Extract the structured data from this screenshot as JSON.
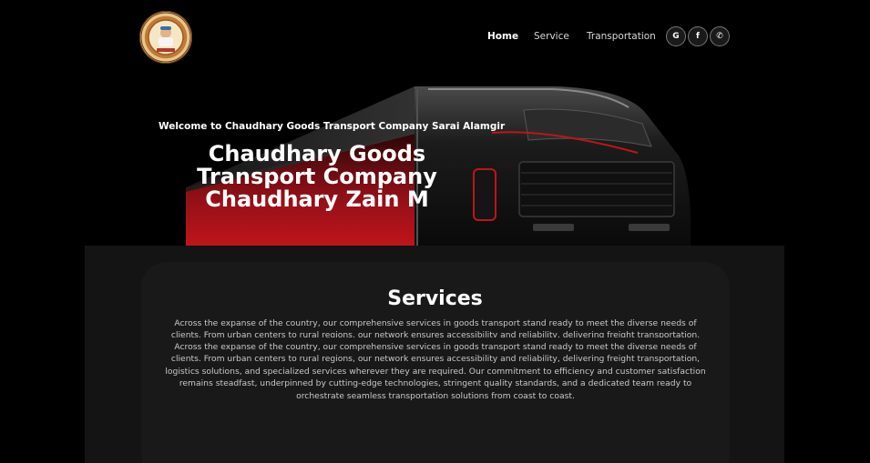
{
  "header": {
    "logo_icon": "company-seal-logo",
    "nav": [
      {
        "label": "Home",
        "active": true
      },
      {
        "label": "Service",
        "active": false
      },
      {
        "label": "Transportation",
        "active": false
      }
    ],
    "social": [
      {
        "icon": "google-icon",
        "glyph": "G"
      },
      {
        "icon": "facebook-icon",
        "glyph": "f"
      },
      {
        "icon": "whatsapp-icon",
        "glyph": "✆"
      }
    ]
  },
  "hero": {
    "welcome": "Welcome to Chaudhary Goods Transport Company Sarai Alamgir",
    "title": "Chaudhary Goods Transport Company Chaudhary Zain M"
  },
  "services": {
    "title": "Services",
    "text": "Across the expanse of the country, our comprehensive services in goods transport stand ready to meet the diverse needs of clients. From urban centers to rural regions, our network ensures accessibility and reliability, delivering freight transportation, logistics solutions, and specialized services wherever they are required. Our commitment to efficiency and customer satisfaction remains steadfast, underpinned by cutting-edge technologies, stringent quality standards, and a dedicated team ready to orchestrate seamless transportation solutions from coast to coast."
  },
  "colors": {
    "background": "#000000",
    "accent_red": "#c0141b",
    "section_bg": "#141414"
  }
}
